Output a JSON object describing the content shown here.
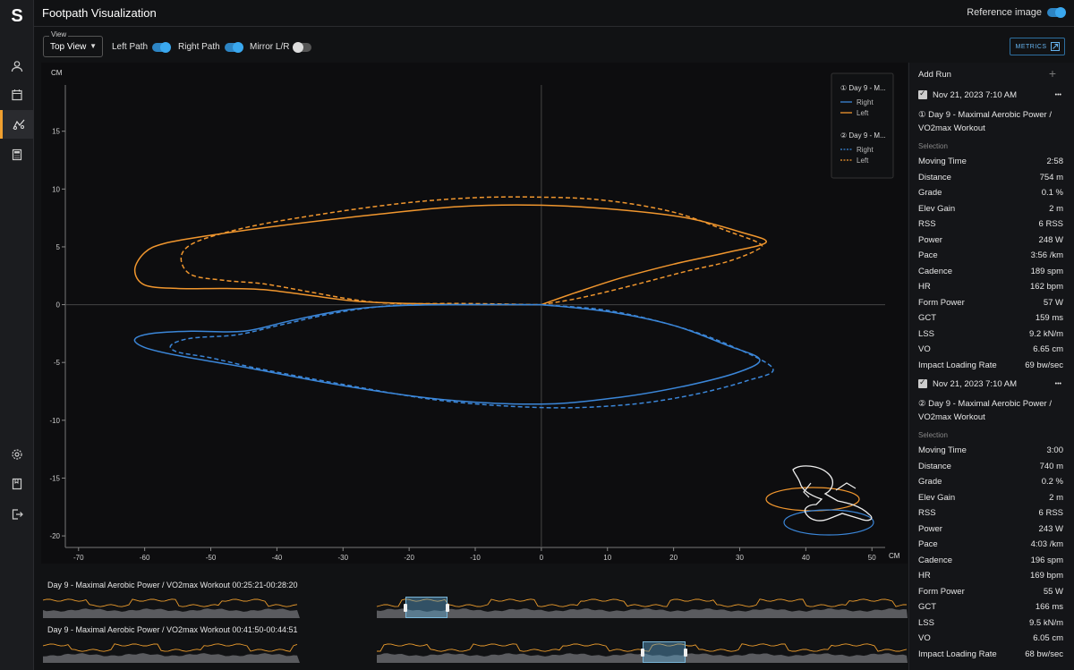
{
  "app": {
    "logo": "S",
    "title": "Footpath Visualization"
  },
  "rail": {
    "items": [
      {
        "name": "athlete-icon"
      },
      {
        "name": "calendar-icon"
      },
      {
        "name": "footpath-icon",
        "active": true
      },
      {
        "name": "calculator-icon"
      },
      {
        "name": "settings-icon"
      },
      {
        "name": "book-icon"
      },
      {
        "name": "logout-icon"
      }
    ]
  },
  "header": {
    "reference_label": "Reference image",
    "reference_on": true
  },
  "controls": {
    "view_caption": "View",
    "view_value": "Top View",
    "left_path_label": "Left Path",
    "right_path_label": "Right Path",
    "mirror_label": "Mirror L/R",
    "metrics_label": "METRICS"
  },
  "chart_data": {
    "type": "line",
    "unit_y": "CM",
    "unit_x": "CM",
    "xlim": [
      -72,
      52
    ],
    "ylim": [
      -21,
      19
    ],
    "x_ticks": [
      -70,
      -60,
      -50,
      -40,
      -30,
      -20,
      -10,
      0,
      10,
      20,
      30,
      40,
      50
    ],
    "y_ticks": [
      15,
      10,
      5,
      0,
      -5,
      -10,
      -15,
      -20
    ],
    "colors": {
      "right": "#3b86d8",
      "left": "#f0962e"
    },
    "legend": [
      {
        "group": "① Day 9 - M...",
        "entries": [
          {
            "name": "Right",
            "style": "solid"
          },
          {
            "name": "Left",
            "style": "solid"
          }
        ]
      },
      {
        "group": "② Day 9 - M...",
        "entries": [
          {
            "name": "Right",
            "style": "dashed"
          },
          {
            "name": "Left",
            "style": "dashed"
          }
        ]
      }
    ],
    "series": [
      {
        "run": 1,
        "foot": "Left",
        "style": "solid",
        "points": [
          [
            0,
            0
          ],
          [
            5,
            1
          ],
          [
            12,
            2.3
          ],
          [
            20,
            3.5
          ],
          [
            28,
            4.5
          ],
          [
            34,
            5.4
          ],
          [
            30,
            6.3
          ],
          [
            22,
            7.5
          ],
          [
            12,
            8.2
          ],
          [
            0,
            8.6
          ],
          [
            -12,
            8.5
          ],
          [
            -25,
            7.8
          ],
          [
            -40,
            6.8
          ],
          [
            -50,
            6
          ],
          [
            -57,
            5.3
          ],
          [
            -60,
            4.5
          ],
          [
            -61.5,
            3
          ],
          [
            -60,
            1.7
          ],
          [
            -55,
            1.4
          ],
          [
            -48,
            1.4
          ],
          [
            -42,
            1.3
          ],
          [
            -35,
            0.8
          ],
          [
            -28,
            0.3
          ],
          [
            -20,
            0.1
          ],
          [
            -10,
            0
          ],
          [
            0,
            0
          ]
        ]
      },
      {
        "run": 2,
        "foot": "Left",
        "style": "dashed",
        "points": [
          [
            0,
            0
          ],
          [
            6,
            0.6
          ],
          [
            14,
            1.7
          ],
          [
            22,
            2.9
          ],
          [
            28,
            3.7
          ],
          [
            32.5,
            4.7
          ],
          [
            33,
            5.3
          ],
          [
            28,
            6.4
          ],
          [
            20,
            8
          ],
          [
            10,
            9
          ],
          [
            0,
            9.3
          ],
          [
            -12,
            9.2
          ],
          [
            -25,
            8.5
          ],
          [
            -40,
            7.2
          ],
          [
            -48,
            6.2
          ],
          [
            -53,
            5.2
          ],
          [
            -54.5,
            4
          ],
          [
            -53,
            2.6
          ],
          [
            -48,
            2.1
          ],
          [
            -42,
            1.8
          ],
          [
            -35,
            1.1
          ],
          [
            -28,
            0.4
          ],
          [
            -22,
            0.1
          ],
          [
            -12,
            0.1
          ],
          [
            0,
            0
          ]
        ]
      },
      {
        "run": 1,
        "foot": "Right",
        "style": "solid",
        "points": [
          [
            0,
            0
          ],
          [
            10,
            -0.6
          ],
          [
            20,
            -1.8
          ],
          [
            28,
            -3.5
          ],
          [
            33,
            -4.7
          ],
          [
            30,
            -5.8
          ],
          [
            22,
            -7
          ],
          [
            12,
            -8
          ],
          [
            0,
            -8.6
          ],
          [
            -15,
            -8.2
          ],
          [
            -30,
            -7
          ],
          [
            -45,
            -5.4
          ],
          [
            -55,
            -4.4
          ],
          [
            -60,
            -3.7
          ],
          [
            -61.5,
            -3
          ],
          [
            -59,
            -2.5
          ],
          [
            -53,
            -2.3
          ],
          [
            -45,
            -2.3
          ],
          [
            -38,
            -1.4
          ],
          [
            -30,
            -0.5
          ],
          [
            -22,
            -0.1
          ],
          [
            -12,
            0
          ],
          [
            0,
            0
          ]
        ]
      },
      {
        "run": 2,
        "foot": "Right",
        "style": "dashed",
        "points": [
          [
            0,
            0
          ],
          [
            10,
            -0.5
          ],
          [
            20,
            -1.8
          ],
          [
            28,
            -3.4
          ],
          [
            35,
            -5.5
          ],
          [
            31,
            -6.6
          ],
          [
            22,
            -7.9
          ],
          [
            12,
            -8.7
          ],
          [
            0,
            -8.9
          ],
          [
            -15,
            -8.3
          ],
          [
            -30,
            -6.9
          ],
          [
            -43,
            -5.5
          ],
          [
            -50,
            -4.6
          ],
          [
            -55,
            -4.1
          ],
          [
            -56,
            -3.5
          ],
          [
            -53,
            -2.9
          ],
          [
            -46,
            -2.6
          ],
          [
            -39,
            -1.7
          ],
          [
            -31,
            -0.7
          ],
          [
            -23,
            -0.1
          ],
          [
            -14,
            0
          ],
          [
            0,
            0
          ]
        ]
      }
    ]
  },
  "panel": {
    "add_run_label": "Add Run",
    "runs": [
      {
        "date": "Nov 21, 2023 7:10 AM",
        "name": "① Day 9 - Maximal Aerobic Power / VO2max Workout",
        "selection_label": "Selection",
        "metrics": [
          {
            "label": "Moving Time",
            "value": "2:58"
          },
          {
            "label": "Distance",
            "value": "754 m"
          },
          {
            "label": "Grade",
            "value": "0.1 %"
          },
          {
            "label": "Elev Gain",
            "value": "2 m"
          },
          {
            "label": "RSS",
            "value": "6 RSS"
          },
          {
            "label": "Power",
            "value": "248 W"
          },
          {
            "label": "Pace",
            "value": "3:56 /km"
          },
          {
            "label": "Cadence",
            "value": "189 spm"
          },
          {
            "label": "HR",
            "value": "162 bpm"
          },
          {
            "label": "Form Power",
            "value": "57 W"
          },
          {
            "label": "GCT",
            "value": "159 ms"
          },
          {
            "label": "LSS",
            "value": "9.2 kN/m"
          },
          {
            "label": "VO",
            "value": "6.65 cm"
          },
          {
            "label": "Impact Loading Rate",
            "value": "69 bw/sec"
          }
        ]
      },
      {
        "date": "Nov 21, 2023 7:10 AM",
        "name": "② Day 9 - Maximal Aerobic Power / VO2max Workout",
        "selection_label": "Selection",
        "metrics": [
          {
            "label": "Moving Time",
            "value": "3:00"
          },
          {
            "label": "Distance",
            "value": "740 m"
          },
          {
            "label": "Grade",
            "value": "0.2 %"
          },
          {
            "label": "Elev Gain",
            "value": "2 m"
          },
          {
            "label": "RSS",
            "value": "6 RSS"
          },
          {
            "label": "Power",
            "value": "243 W"
          },
          {
            "label": "Pace",
            "value": "4:03 /km"
          },
          {
            "label": "Cadence",
            "value": "196 spm"
          },
          {
            "label": "HR",
            "value": "169 bpm"
          },
          {
            "label": "Form Power",
            "value": "55 W"
          },
          {
            "label": "GCT",
            "value": "166 ms"
          },
          {
            "label": "LSS",
            "value": "9.5 kN/m"
          },
          {
            "label": "VO",
            "value": "6.05 cm"
          },
          {
            "label": "Impact Loading Rate",
            "value": "68 bw/sec"
          }
        ]
      }
    ]
  },
  "timeline": {
    "tracks": [
      {
        "label": "Day 9 - Maximal Aerobic Power / VO2max Workout  00:25:21-00:28:20",
        "selection": [
          0.419,
          0.468
        ]
      },
      {
        "label": "Day 9 - Maximal Aerobic Power / VO2max Workout  00:41:50-00:44:51",
        "selection": [
          0.694,
          0.743
        ]
      }
    ]
  }
}
